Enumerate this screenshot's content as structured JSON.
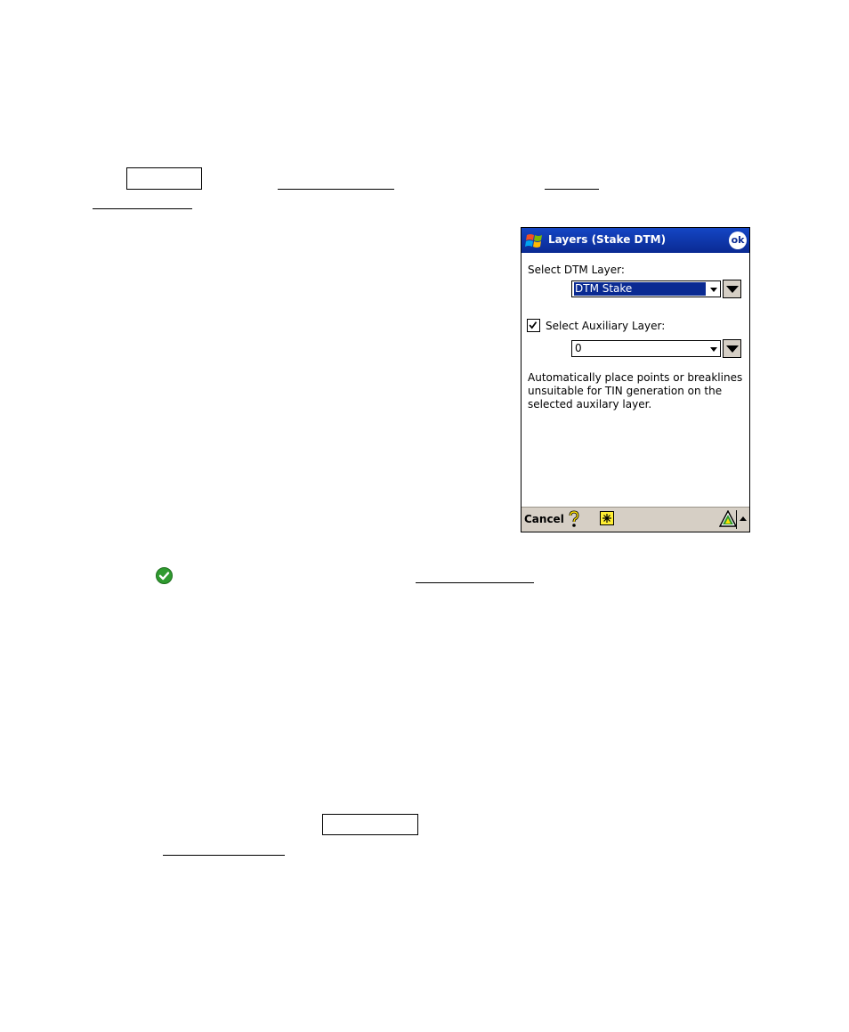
{
  "window": {
    "title": "Layers (Stake DTM)",
    "ok_label": "ok"
  },
  "dtm_layer": {
    "label": "Select DTM Layer:",
    "value": "DTM Stake"
  },
  "auxiliary_layer": {
    "checked": true,
    "label": "Select Auxiliary Layer:",
    "value": "0"
  },
  "description": "Automatically place points or breaklines unsuitable for TIN generation on the selected auxilary layer.",
  "menubar": {
    "cancel_label": "Cancel"
  },
  "icons": {
    "start": "windows-start-icon",
    "help": "help-question-icon",
    "star": "star-icon",
    "survey": "survey-triangle-icon",
    "sip": "sip-up-arrow-icon",
    "page_check": "green-check-icon"
  },
  "colors": {
    "titlebar": "#0a2a92",
    "selection": "#0a2a92",
    "menubar": "#d6cfc5",
    "check_green": "#2f9a2f"
  }
}
